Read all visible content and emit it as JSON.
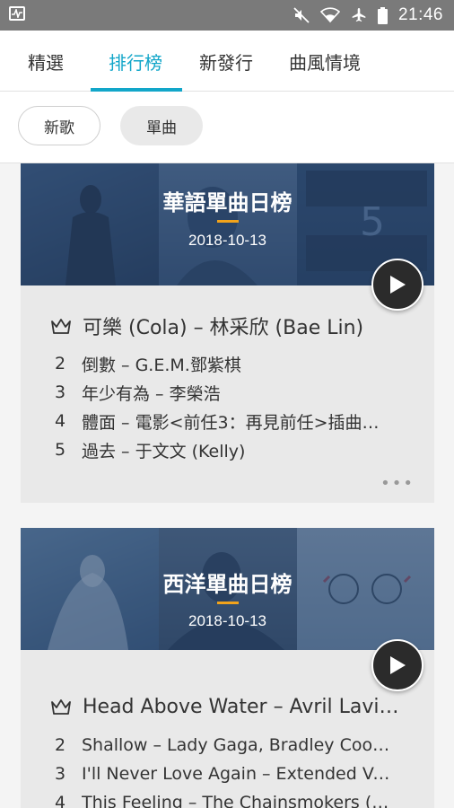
{
  "status_bar": {
    "time": "21:46",
    "icons": [
      "activity-monitor-icon",
      "mute-icon",
      "wifi-icon",
      "airplane-icon",
      "battery-icon"
    ]
  },
  "nav": {
    "tabs": [
      {
        "label": "精選",
        "active": false
      },
      {
        "label": "排行榜",
        "active": true
      },
      {
        "label": "新發行",
        "active": false
      },
      {
        "label": "曲風情境",
        "active": false
      }
    ]
  },
  "filters": {
    "new_songs": "新歌",
    "singles": "單曲"
  },
  "charts": [
    {
      "title": "華語單曲日榜",
      "date": "2018-10-13",
      "top": "可樂 (Cola) – 林采欣 (Bae Lin)",
      "items": [
        {
          "rank": "2",
          "text": "倒數 – G.E.M.鄧紫棋"
        },
        {
          "rank": "3",
          "text": "年少有為 – 李榮浩"
        },
        {
          "rank": "4",
          "text": "體面 – 電影<前任3：再見前任>插曲…"
        },
        {
          "rank": "5",
          "text": "過去 – 于文文 (Kelly)"
        }
      ],
      "more": "•••"
    },
    {
      "title": "西洋單曲日榜",
      "date": "2018-10-13",
      "top": "Head Above Water – Avril Lavi…",
      "items": [
        {
          "rank": "2",
          "text": "Shallow – Lady Gaga, Bradley Coop…"
        },
        {
          "rank": "3",
          "text": "I'll Never Love Again – Extended Ve…"
        },
        {
          "rank": "4",
          "text": "This Feeling – The Chainsmokers (…"
        }
      ]
    }
  ],
  "colors": {
    "accent": "#12a6c9",
    "banner_accent": "#f2a31b"
  }
}
